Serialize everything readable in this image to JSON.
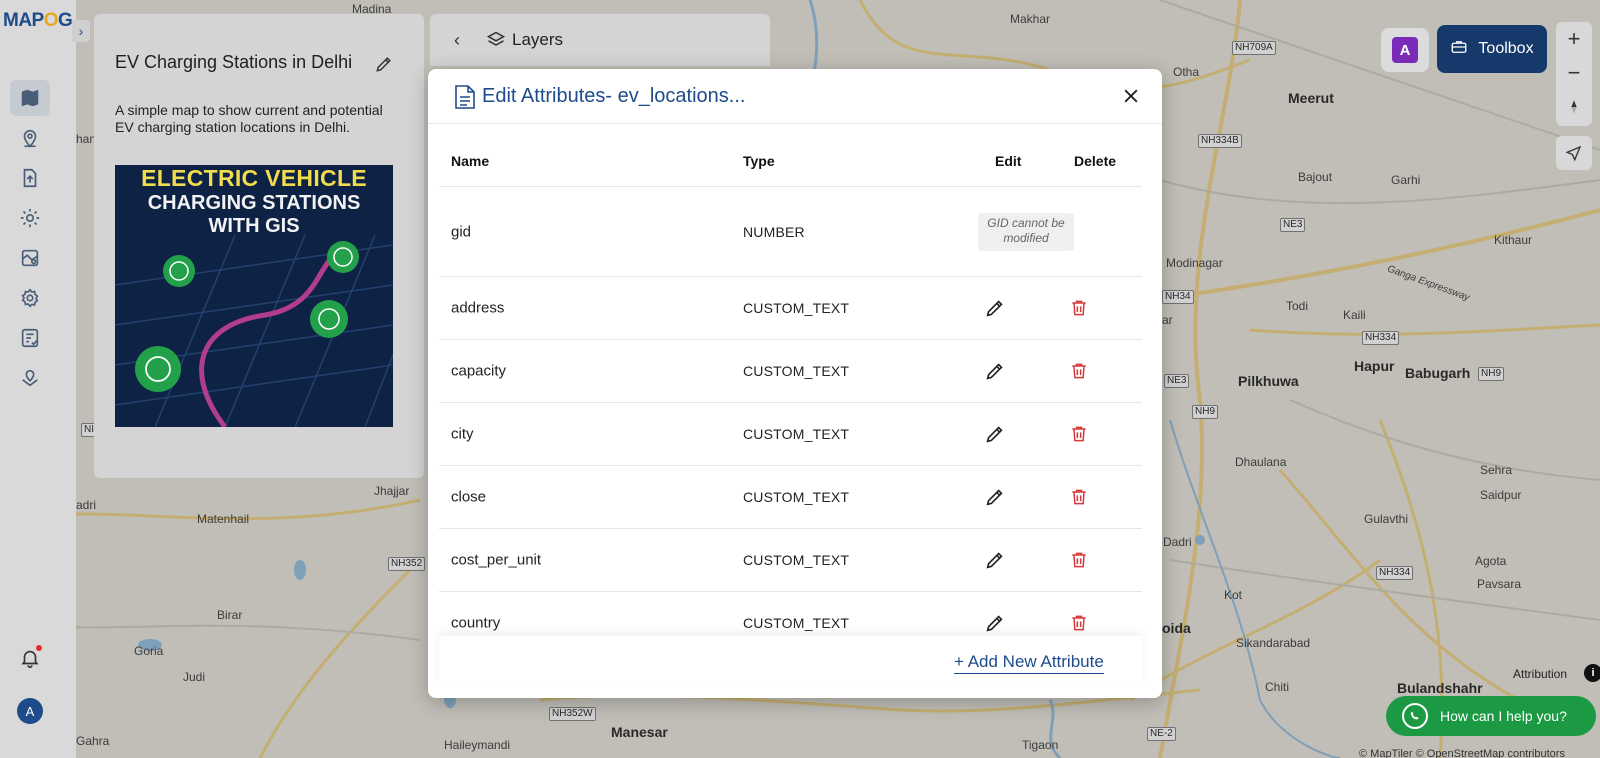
{
  "app": {
    "logo_text_a": "MAP",
    "logo_text_o": "O",
    "logo_text_b": "G"
  },
  "rail": {
    "items": [
      {
        "icon": "map-icon"
      },
      {
        "icon": "location-pin-icon"
      },
      {
        "icon": "upload-file-icon"
      },
      {
        "icon": "processing-gear-icon"
      },
      {
        "icon": "map-layers-icon"
      },
      {
        "icon": "settings-icon"
      },
      {
        "icon": "report-icon"
      },
      {
        "icon": "data-collection-icon"
      }
    ],
    "avatar_letter": "A"
  },
  "story": {
    "title": "EV Charging Stations in Delhi",
    "description": "A simple map to show current and potential EV charging station locations in Delhi.",
    "image_line1": "ELECTRIC VEHICLE",
    "image_line2": "CHARGING STATIONS",
    "image_line3": "WITH GIS"
  },
  "layers": {
    "label": "Layers"
  },
  "toolbox": {
    "label": "Toolbox",
    "ai_label": "A"
  },
  "zoom": {
    "in": "+",
    "out": "−"
  },
  "attribution": {
    "label": "Attribution",
    "info": "i",
    "copyright": "© MapTiler © OpenStreetMap contributors"
  },
  "help": {
    "label": "How can I help you?"
  },
  "modal": {
    "title": "Edit Attributes- ev_locations...",
    "columns": {
      "name": "Name",
      "type": "Type",
      "edit": "Edit",
      "delete": "Delete"
    },
    "gid_note": "GID cannot be modified",
    "rows": [
      {
        "name": "gid",
        "type": "NUMBER"
      },
      {
        "name": "address",
        "type": "CUSTOM_TEXT"
      },
      {
        "name": "capacity",
        "type": "CUSTOM_TEXT"
      },
      {
        "name": "city",
        "type": "CUSTOM_TEXT"
      },
      {
        "name": "close",
        "type": "CUSTOM_TEXT"
      },
      {
        "name": "cost_per_unit",
        "type": "CUSTOM_TEXT"
      },
      {
        "name": "country",
        "type": "CUSTOM_TEXT"
      }
    ],
    "add_label": "+ Add New Attribute"
  },
  "map": {
    "labels": [
      "Madina",
      "Makhar",
      "Otha",
      "Meerut",
      "Bajout",
      "Garhi",
      "Kithaur",
      "Modinagar",
      "Todi",
      "Kaili",
      "Hapur",
      "Babugarh",
      "Pilkhuwa",
      "Dhaulana",
      "Sehra",
      "Saidpur",
      "Gulavthi",
      "Dadri",
      "Agota",
      "Pavsara",
      "Kot",
      "Sikandarabad",
      "Chiti",
      "Bulandshahr",
      "Tigaon",
      "Manesar",
      "Haileymandi",
      "Gahra",
      "Judi",
      "Goria",
      "Birar",
      "Matenhail",
      "Jhajjar",
      "adri",
      "Ganga Expressway",
      "oida",
      "ar",
      "han"
    ],
    "shields": [
      "NH709A",
      "NH334B",
      "NE3",
      "NH34",
      "NH334",
      "NE3",
      "NH9",
      "NH9",
      "NH334",
      "NH352",
      "NH352W",
      "NE-2",
      "NI",
      "NI"
    ]
  },
  "colors": {
    "brand": "#1e4c8a",
    "danger": "#d63a3a",
    "whatsapp": "#1c9a43"
  }
}
